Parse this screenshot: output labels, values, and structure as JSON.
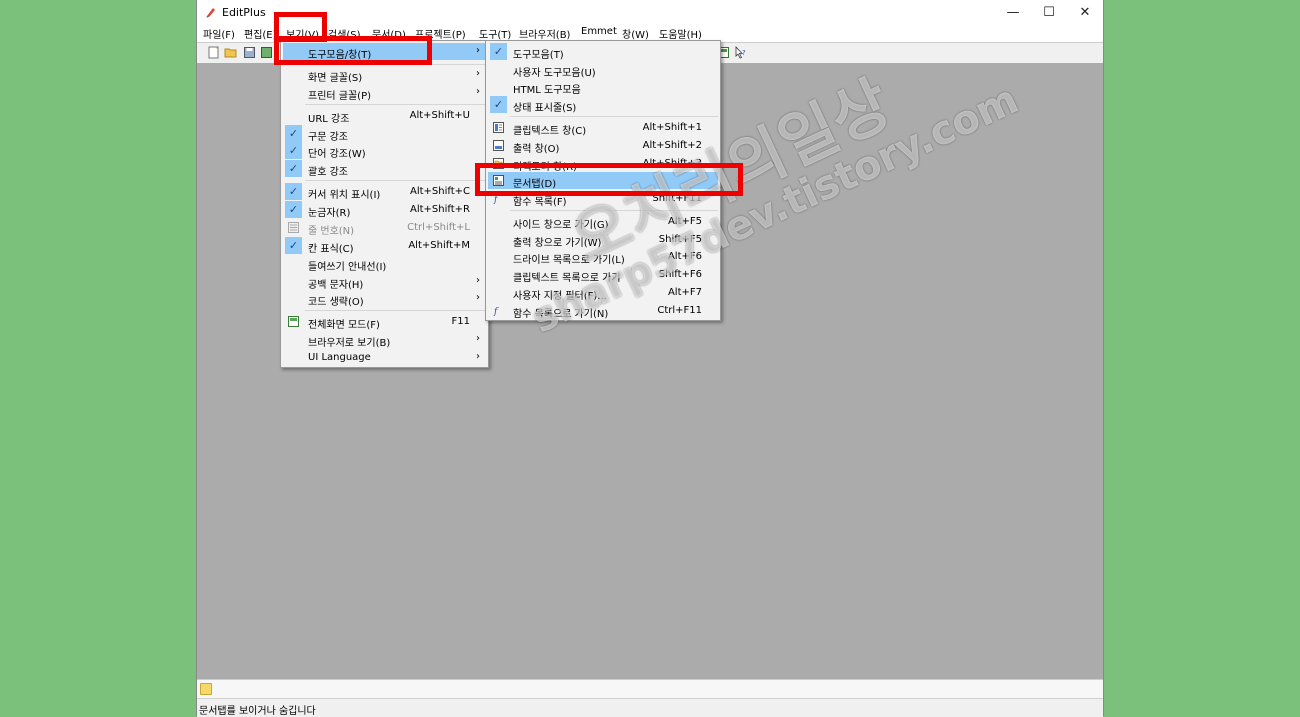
{
  "window": {
    "title": "EditPlus",
    "controls": {
      "minimize": "—",
      "maximize": "☐",
      "close": "✕"
    }
  },
  "menubar": {
    "items": [
      "파일(F)",
      "편집(E)",
      "보기(V)",
      "검색(S)",
      "문서(D)",
      "프로젝트(P)",
      "도구(T)",
      "브라우저(B)",
      "Emmet",
      "창(W)",
      "도움말(H)"
    ]
  },
  "view_menu": {
    "items": [
      {
        "label": "도구모음/창(T)",
        "arrow": "›"
      },
      {
        "label": "화면 글꼴(S)",
        "arrow": "›"
      },
      {
        "label": "프린터 글꼴(P)",
        "arrow": "›"
      },
      {
        "label": "URL 강조",
        "accel": "Alt+Shift+U"
      },
      {
        "label": "구문 강조",
        "check": "✓"
      },
      {
        "label": "단어 강조(W)",
        "check": "✓"
      },
      {
        "label": "괄호 강조",
        "check": "✓"
      },
      {
        "label": "커서 위치 표시(I)",
        "accel": "Alt+Shift+C",
        "check": "✓"
      },
      {
        "label": "눈금자(R)",
        "accel": "Alt+Shift+R",
        "check": "✓"
      },
      {
        "label": "줄 번호(N)",
        "accel": "Ctrl+Shift+L"
      },
      {
        "label": "칸 표식(C)",
        "accel": "Alt+Shift+M",
        "check": "✓"
      },
      {
        "label": "들여쓰기 안내선(I)"
      },
      {
        "label": "공백 문자(H)",
        "arrow": "›"
      },
      {
        "label": "코드 생략(O)",
        "arrow": "›"
      },
      {
        "label": "전체화면 모드(F)",
        "accel": "F11"
      },
      {
        "label": "브라우저로 보기(B)",
        "arrow": "›"
      },
      {
        "label": "UI Language",
        "arrow": "›"
      }
    ]
  },
  "toolbar_submenu": {
    "items": [
      {
        "label": "도구모음(T)",
        "check": "✓"
      },
      {
        "label": "사용자 도구모음(U)"
      },
      {
        "label": "HTML 도구모음"
      },
      {
        "label": "상태 표시줄(S)",
        "check": "✓"
      },
      {
        "label": "클립텍스트 창(C)",
        "accel": "Alt+Shift+1"
      },
      {
        "label": "출력 창(O)",
        "accel": "Alt+Shift+2"
      },
      {
        "label": "디렉토리 창(R)",
        "accel": "Alt+Shift+3"
      },
      {
        "label": "문서탭(D)"
      },
      {
        "label": "함수 목록(F)",
        "accel": "Shift+F11"
      },
      {
        "label": "사이드 창으로 가기(G)",
        "accel": "Alt+F5"
      },
      {
        "label": "출력 창으로 가기(W)",
        "accel": "Shift+F5"
      },
      {
        "label": "드라이브 목록으로 가기(L)",
        "accel": "Alt+F6"
      },
      {
        "label": "클립텍스트 목록으로 가기",
        "accel": "Shift+F6"
      },
      {
        "label": "사용자 지정 필터(F)...",
        "accel": "Alt+F7"
      },
      {
        "label": "함수 목록으로 가기(N)",
        "accel": "Ctrl+F11"
      }
    ]
  },
  "statusbar": {
    "text": "문서탭를 보이거나 숨깁니다"
  },
  "watermark": {
    "line1": "오치리의일상",
    "line2": "sharp57dev.tistory.com"
  },
  "colors": {
    "highlight": "#91c9f7",
    "annotation": "#ee0000",
    "background": "#7bc17b",
    "editor": "#ababab"
  }
}
